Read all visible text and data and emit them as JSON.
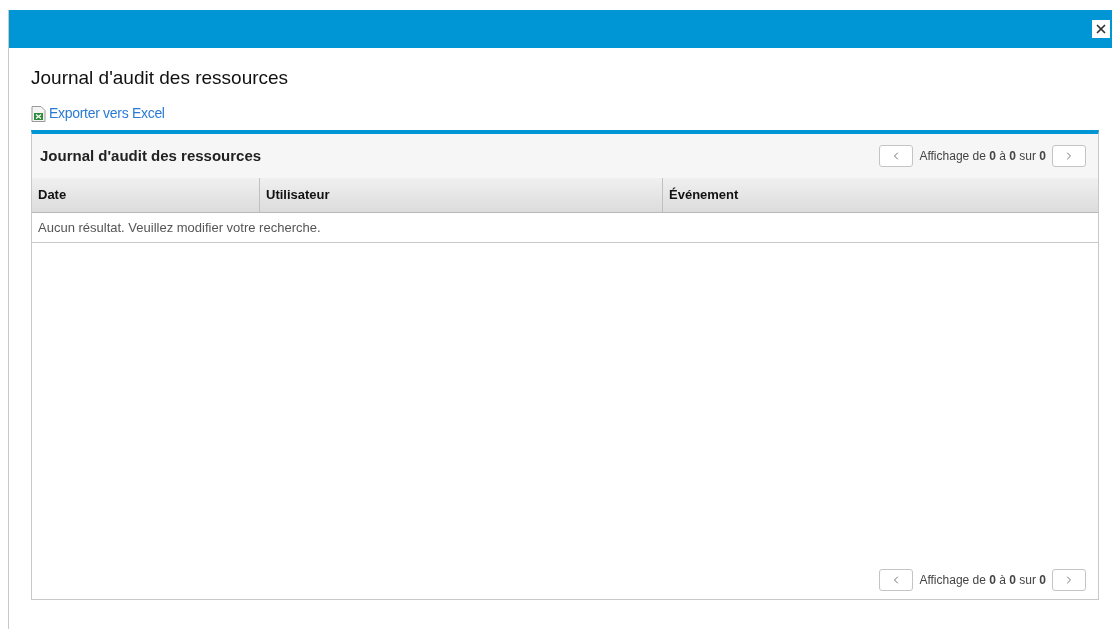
{
  "dialog": {
    "title": "Journal d'audit des ressources",
    "export_link": "Exporter vers Excel"
  },
  "panel": {
    "title": "Journal d'audit des ressources",
    "pagination_top": "Affichage de **0** à **0** sur **0**",
    "pagination_bottom": "Affichage de **0** à **0** sur **0**"
  },
  "table": {
    "columns": [
      "Date",
      "Utilisateur",
      "Événement"
    ],
    "empty_message": "Aucun résultat. Veuillez modifier votre recherche."
  }
}
